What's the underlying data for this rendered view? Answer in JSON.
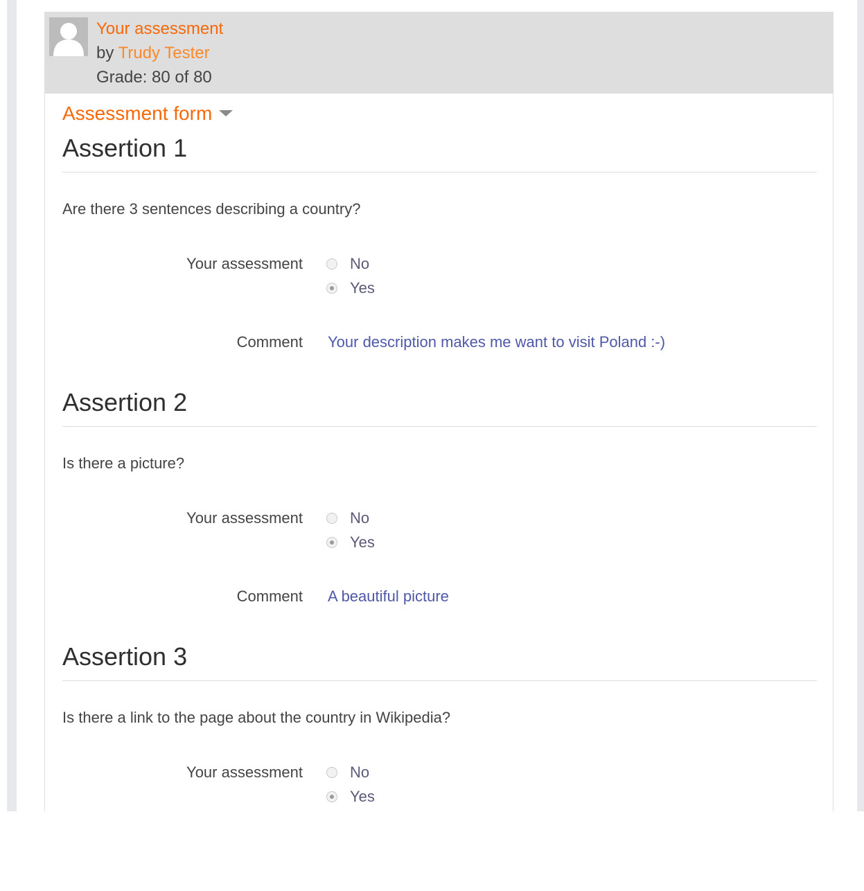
{
  "header": {
    "title": "Your assessment",
    "by_prefix": "by",
    "author": "Trudy Tester",
    "grade": "Grade: 80 of 80"
  },
  "form": {
    "toggle_label": "Assessment form"
  },
  "assertions": [
    {
      "title": "Assertion 1",
      "question": "Are there 3 sentences describing a country?",
      "assessment_label": "Your assessment",
      "options": [
        "No",
        "Yes"
      ],
      "selected": "Yes",
      "comment_label": "Comment",
      "comment": "Your description makes me want to visit Poland :-)"
    },
    {
      "title": "Assertion 2",
      "question": "Is there a picture?",
      "assessment_label": "Your assessment",
      "options": [
        "No",
        "Yes"
      ],
      "selected": "Yes",
      "comment_label": "Comment",
      "comment": "A beautiful picture"
    },
    {
      "title": "Assertion 3",
      "question": "Is there a link to the page about the country in Wikipedia?",
      "assessment_label": "Your assessment",
      "options": [
        "No",
        "Yes"
      ],
      "selected": "Yes",
      "comment_label": "Comment",
      "comment": ""
    }
  ],
  "colors": {
    "accent": "#f76808",
    "header_bg": "#dedede",
    "comment_text": "#4f58a8"
  },
  "icons": {
    "avatar": "user-silhouette-icon",
    "toggle": "caret-down-icon"
  }
}
